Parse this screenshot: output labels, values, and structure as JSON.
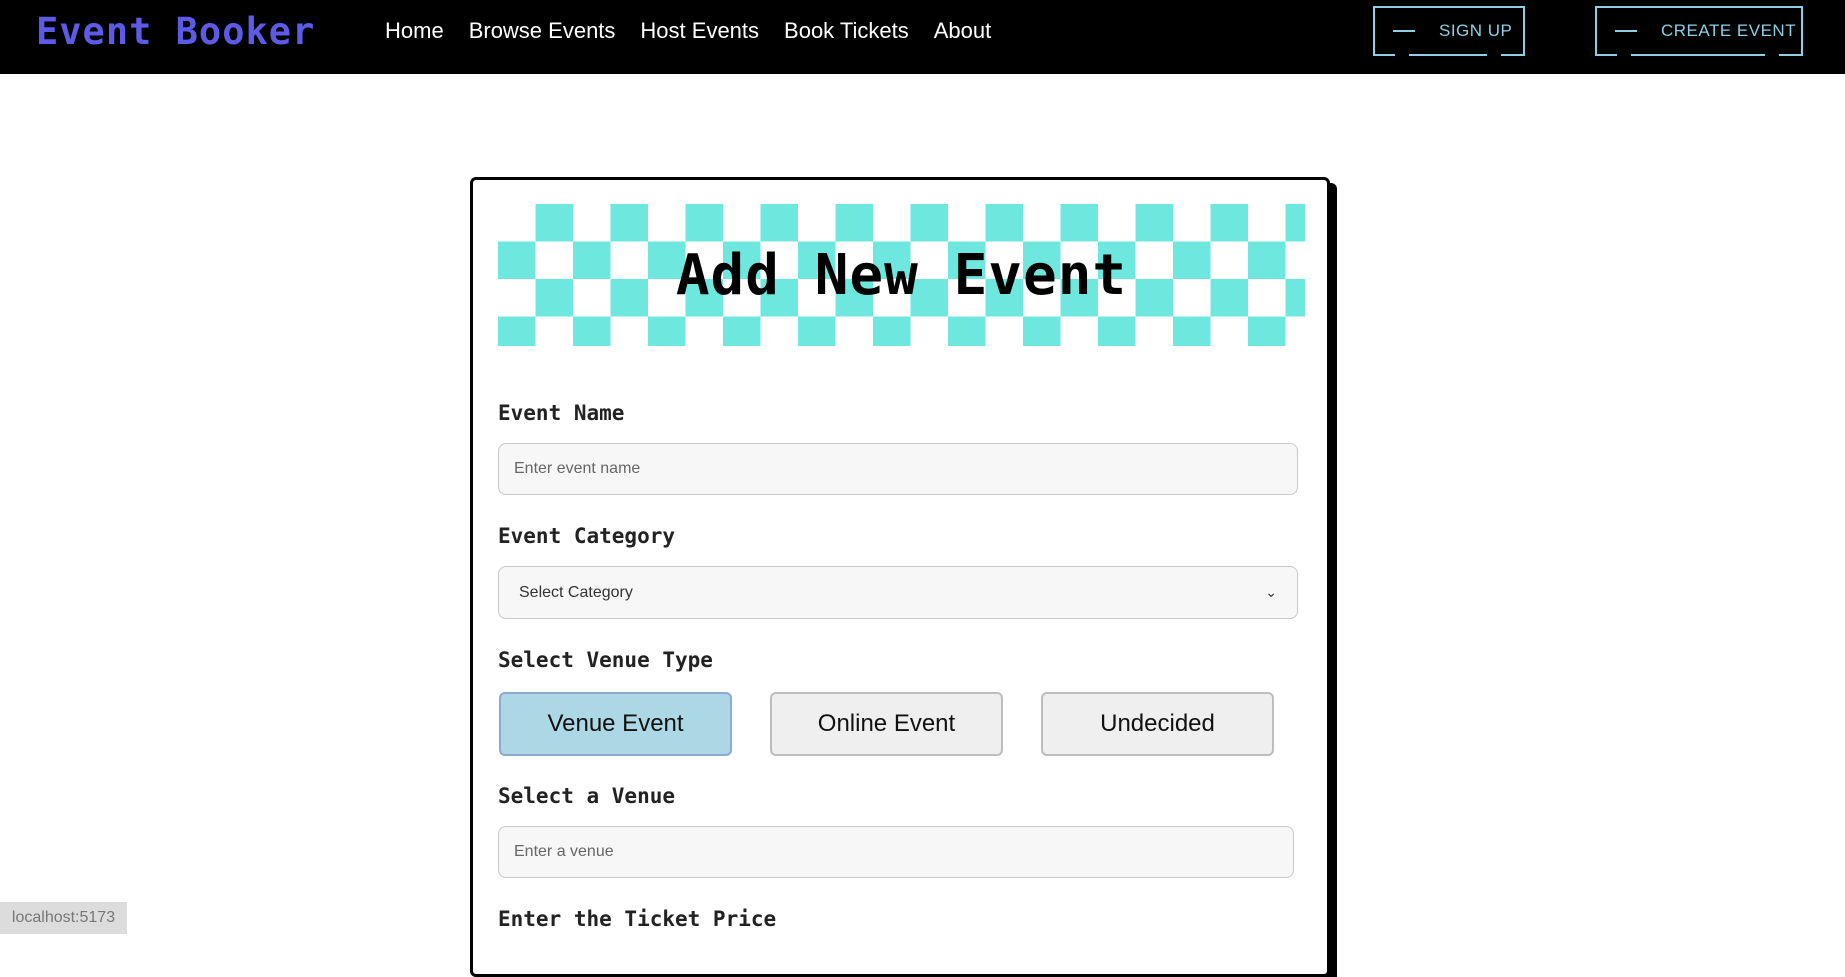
{
  "header": {
    "logo": "Event Booker",
    "nav": [
      "Home",
      "Browse Events",
      "Host Events",
      "Book Tickets",
      "About"
    ],
    "signup_label": "SIGN UP",
    "create_label": "CREATE EVENT"
  },
  "form": {
    "title": "Add New Event",
    "event_name": {
      "label": "Event Name",
      "placeholder": "Enter event name"
    },
    "event_category": {
      "label": "Event Category",
      "selected": "Select Category"
    },
    "venue_type": {
      "label": "Select Venue Type",
      "options": [
        "Venue Event",
        "Online Event",
        "Undecided"
      ],
      "active": "Venue Event"
    },
    "venue": {
      "label": "Select a Venue",
      "placeholder": "Enter a venue"
    },
    "ticket_price": {
      "label": "Enter the Ticket Price"
    }
  },
  "statusbar": {
    "url": "localhost:5173"
  },
  "colors": {
    "header_bg": "#000000",
    "logo": "#5d5ae6",
    "header_button": "#8ecfe8",
    "banner_check": "#6ee8df",
    "active_option": "#acd8e6"
  }
}
